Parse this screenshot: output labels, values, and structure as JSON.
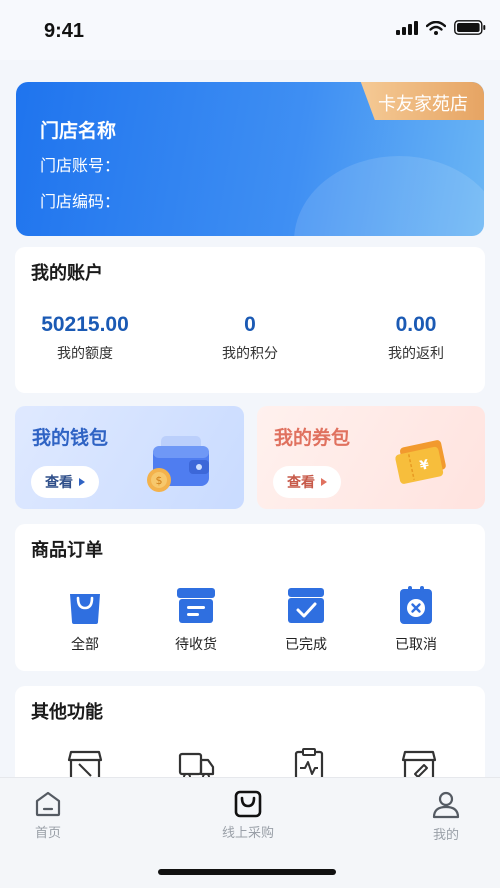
{
  "status": {
    "time": "9:41"
  },
  "store": {
    "badge": "卡友家苑店",
    "name": "门店名称",
    "account_label": "门店账号：",
    "code_label": "门店编码："
  },
  "account": {
    "title": "我的账户",
    "stats": [
      {
        "value": "50215.00",
        "label": "我的额度"
      },
      {
        "value": "0",
        "label": "我的积分"
      },
      {
        "value": "0.00",
        "label": "我的返利"
      }
    ]
  },
  "wallet": {
    "title": "我的钱包",
    "button": "查看"
  },
  "coupons": {
    "title": "我的券包",
    "button": "查看"
  },
  "orders": {
    "title": "商品订单",
    "items": [
      {
        "label": "全部",
        "icon": "shopping-bag-icon"
      },
      {
        "label": "待收货",
        "icon": "box-icon"
      },
      {
        "label": "已完成",
        "icon": "check-box-icon"
      },
      {
        "label": "已取消",
        "icon": "cancel-clipboard-icon"
      }
    ]
  },
  "other": {
    "title": "其他功能",
    "icons": [
      "store-icon",
      "truck-icon",
      "report-icon",
      "shop-edit-icon"
    ]
  },
  "tabbar": {
    "items": [
      {
        "label": "首页",
        "icon": "home-icon"
      },
      {
        "label": "线上采购",
        "icon": "bag-icon",
        "active": true
      },
      {
        "label": "我的",
        "icon": "user-icon"
      }
    ]
  },
  "colors": {
    "primary": "#1f74ee",
    "stat_value": "#1b5ab4",
    "badge": "#e6a463",
    "coupon_accent": "#e0715f",
    "order_icon": "#2f6fe0"
  }
}
